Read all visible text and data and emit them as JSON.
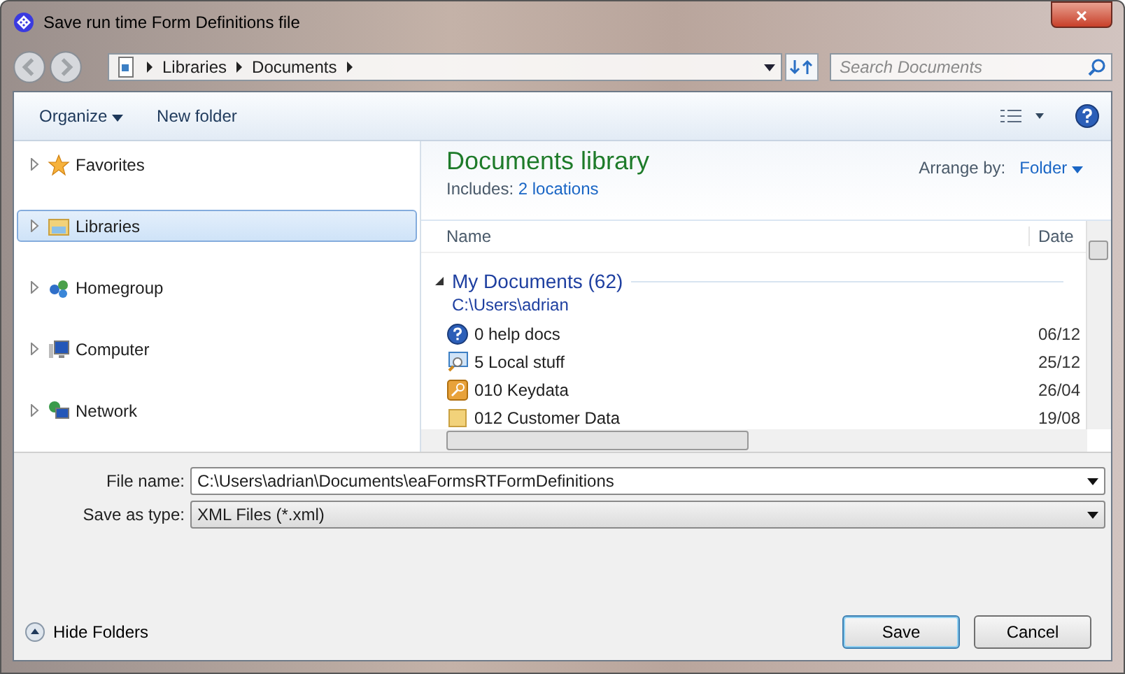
{
  "window": {
    "title": "Save run time Form Definitions file",
    "close": "×"
  },
  "address": {
    "crumbs": [
      "Libraries",
      "Documents"
    ],
    "search_placeholder": "Search Documents"
  },
  "toolbar": {
    "organize": "Organize",
    "new_folder": "New folder"
  },
  "sidebar": {
    "items": [
      {
        "label": "Favorites",
        "kind": "star",
        "selected": false
      },
      {
        "label": "Libraries",
        "kind": "library",
        "selected": true
      },
      {
        "label": "Homegroup",
        "kind": "homegroup",
        "selected": false
      },
      {
        "label": "Computer",
        "kind": "computer",
        "selected": false
      },
      {
        "label": "Network",
        "kind": "network",
        "selected": false
      }
    ]
  },
  "library": {
    "title": "Documents library",
    "includes_label": "Includes:",
    "includes_link": "2 locations",
    "arrange_label": "Arrange by:",
    "arrange_value": "Folder"
  },
  "table": {
    "columns": [
      "Name",
      "Date"
    ],
    "group": {
      "title": "My Documents (62)",
      "path": "C:\\Users\\adrian"
    },
    "rows": [
      {
        "name": "0 help docs",
        "date": "06/12",
        "kind": "help"
      },
      {
        "name": "5 Local stuff",
        "date": "25/12",
        "kind": "search"
      },
      {
        "name": "010 Keydata",
        "date": "26/04",
        "kind": "key"
      },
      {
        "name": "012 Customer Data",
        "date": "19/08",
        "kind": "folder"
      }
    ]
  },
  "form": {
    "file_name_label": "File name:",
    "file_name": "C:\\Users\\adrian\\Documents\\eaFormsRTFormDefinitions",
    "type_label": "Save as type:",
    "type_value": "XML Files (*.xml)"
  },
  "footer": {
    "hide_folders": "Hide Folders",
    "save": "Save",
    "cancel": "Cancel"
  }
}
